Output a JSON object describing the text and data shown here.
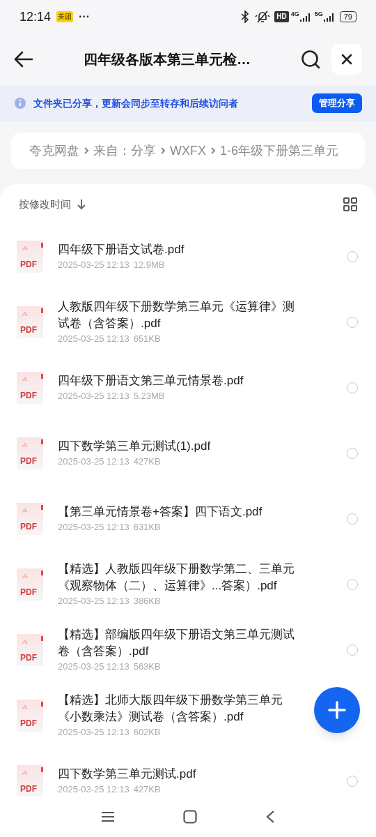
{
  "status_bar": {
    "time": "12:14",
    "app_badge": "美团",
    "more": "···",
    "network_hd": "HD",
    "network_4g": "4G",
    "network_5g": "5G",
    "battery": "79"
  },
  "header": {
    "title": "四年级各版本第三单元检…"
  },
  "banner": {
    "message": "文件夹已分享，更新会同步至转存和后续访问者",
    "button": "管理分享"
  },
  "breadcrumb": [
    "夸克网盘",
    "来自：分享",
    "WXFX",
    "1-6年级下册第三单元"
  ],
  "sort": {
    "label": "按修改时间"
  },
  "files": [
    {
      "name": "四年级下册语文试卷.pdf",
      "date": "2025-03-25 12:13",
      "size": "12.9MB",
      "icon_label": "PDF",
      "selected": false
    },
    {
      "name": "人教版四年级下册数学第三单元《运算律》测试卷（含答案）.pdf",
      "date": "2025-03-25 12:13",
      "size": "651KB",
      "icon_label": "PDF",
      "selected": false
    },
    {
      "name": "四年级下册语文第三单元情景卷.pdf",
      "date": "2025-03-25 12:13",
      "size": "5.23MB",
      "icon_label": "PDF",
      "selected": false
    },
    {
      "name": "四下数学第三单元测试(1).pdf",
      "date": "2025-03-25 12:13",
      "size": "427KB",
      "icon_label": "PDF",
      "selected": false
    },
    {
      "name": "【第三单元情景卷+答案】四下语文.pdf",
      "date": "2025-03-25 12:13",
      "size": "631KB",
      "icon_label": "PDF",
      "selected": false
    },
    {
      "name": "【精选】人教版四年级下册数学第二、三单元《观察物体（二）、运算律》...答案）.pdf",
      "date": "2025-03-25 12:13",
      "size": "386KB",
      "icon_label": "PDF",
      "selected": false
    },
    {
      "name": "【精选】部编版四年级下册语文第三单元测试卷（含答案）.pdf",
      "date": "2025-03-25 12:13",
      "size": "563KB",
      "icon_label": "PDF",
      "selected": false
    },
    {
      "name": "【精选】北师大版四年级下册数学第三单元《小数乘法》测试卷（含答案）.pdf",
      "date": "2025-03-25 12:13",
      "size": "602KB",
      "icon_label": "PDF"
    },
    {
      "name": "四下数学第三单元测试.pdf",
      "date": "2025-03-25 12:13",
      "size": "427KB",
      "icon_label": "PDF",
      "selected": false
    }
  ]
}
